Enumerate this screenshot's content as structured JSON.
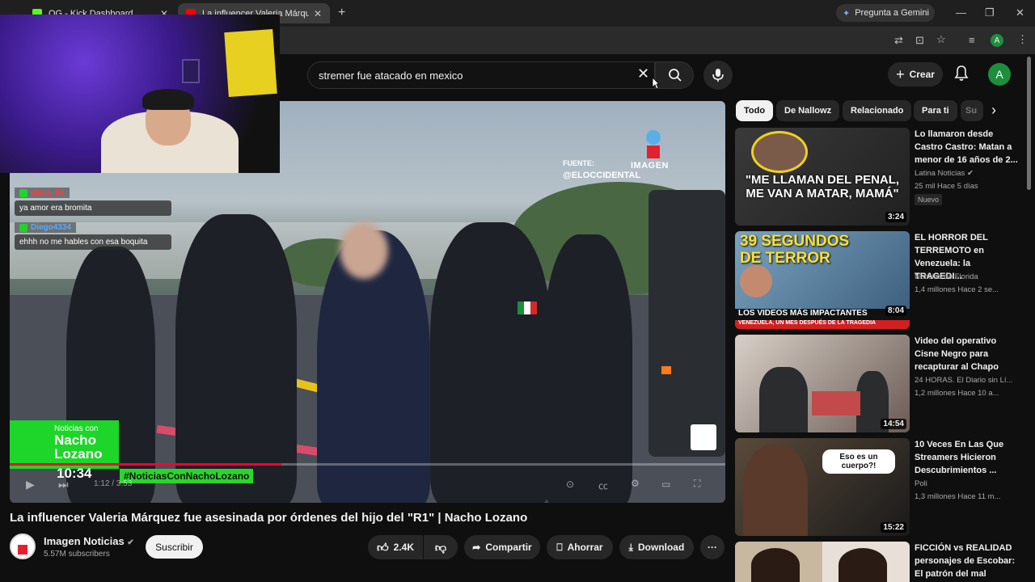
{
  "browser": {
    "tabs": [
      {
        "title": "OG - Kick Dashboard",
        "favicon_color": "#53fc18"
      },
      {
        "title": "La influencer Valeria Márquez fu",
        "favicon_color": "#ff0000"
      }
    ],
    "new_tab": "+",
    "gemini_label": "Pregunta a Gemini",
    "profile_letter": "A"
  },
  "header": {
    "search_value": "stremer fue atacado en mexico",
    "create_label": "Crear",
    "avatar_letter": "A"
  },
  "stream_overlay": {
    "chat": [
      {
        "user": "alexa_lix",
        "message": "ya amor era bromita",
        "color": "#ff3b3b"
      },
      {
        "user": "Diego4334",
        "message": "ehhh no me hables con esa boquita",
        "color": "#5aa8ff"
      }
    ]
  },
  "video": {
    "source_label": "FUENTE:",
    "source_handle": "@ELOCCIDENTAL",
    "brand": "IMAGEN",
    "ticker_small": "Noticias con",
    "ticker_name_1": "Nacho",
    "ticker_name_2": "Lozano",
    "ticker_time": "10:34",
    "hashtag": "#NoticiasConNachoLozano",
    "time_display": "1:12 / 3:53"
  },
  "meta": {
    "title": "La influencer Valeria Márquez fue asesinada por órdenes del hijo del \"R1\" | Nacho Lozano",
    "channel": "Imagen Noticias",
    "subscribers": "5.57M subscribers",
    "subscribe_label": "Suscribir",
    "likes": "2.4K",
    "share_label": "Compartir",
    "save_label": "Ahorrar",
    "download_label": "Download"
  },
  "chips": [
    "Todo",
    "De Nallowz",
    "Relacionado",
    "Para ti",
    "Su"
  ],
  "related": [
    {
      "title": "Lo llamaron desde Castro Castro: Matan a menor de 16 años de 2...",
      "channel": "Latina Noticias",
      "verified": true,
      "meta": "25 mil  Hace 5 días",
      "badge": "Nuevo",
      "duration": "3:24",
      "thumb_text": "\"ME LLAMAN DEL PENAL, ME VAN A MATAR, MAMÁ\""
    },
    {
      "title": "EL HORROR DEL TERREMOTO en Venezuela: la TRAGEDI...",
      "channel": "Noticias de Florida",
      "meta": "1,4 millones  Hace 2 se...",
      "duration": "8:04",
      "thumb_top": "39 SEGUNDOS DE TERROR",
      "thumb_bottom": "LOS VIDEOS MÁS IMPACTANTES",
      "thumb_sub": "VENEZUELA, UN MES DESPUÉS DE LA TRAGEDIA"
    },
    {
      "title": "Video del operativo Cisne Negro para recapturar al Chapo",
      "channel": "24 HORAS. El Diario sin Lí...",
      "meta": "1,2 millones  Hace 10 a...",
      "duration": "14:54"
    },
    {
      "title": "10 Veces En Las Que Streamers Hicieron Descubrimientos ...",
      "channel": "Poli",
      "meta": "1,3 millones  Hace 11 m...",
      "duration": "15:22",
      "thumb_text": "Eso es un cuerpo?!"
    },
    {
      "title": "FICCIÓN vs REALIDAD personajes de Escobar: El patrón del mal",
      "channel": "",
      "meta": "",
      "duration": ""
    }
  ]
}
